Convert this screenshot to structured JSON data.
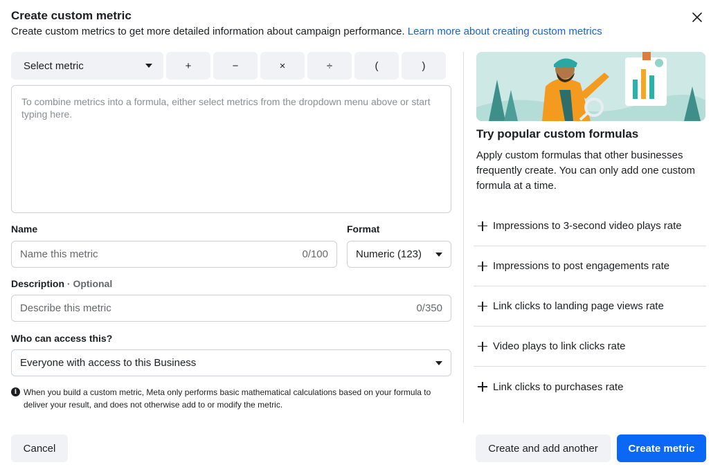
{
  "dialog": {
    "title": "Create custom metric",
    "subtitle": "Create custom metrics to get more detailed information about campaign performance.",
    "learn_more": "Learn more about creating custom metrics"
  },
  "toolbar": {
    "select_metric": "Select metric",
    "operators": [
      "+",
      "−",
      "×",
      "÷",
      "(",
      ")"
    ]
  },
  "formula": {
    "placeholder": "To combine metrics into a formula, either select metrics from the dropdown menu above or start typing here."
  },
  "name": {
    "label": "Name",
    "placeholder": "Name this metric",
    "count": "0/100"
  },
  "format": {
    "label": "Format",
    "value": "Numeric (123)"
  },
  "description": {
    "label": "Description",
    "optional": "· Optional",
    "placeholder": "Describe this metric",
    "count": "0/350"
  },
  "access": {
    "label": "Who can access this?",
    "value": "Everyone with access to this Business"
  },
  "note": "When you build a custom metric, Meta only performs basic mathematical calculations based on your formula to deliver your result, and does not otherwise add to or modify the metric.",
  "sidebar": {
    "title": "Try popular custom formulas",
    "description": "Apply custom formulas that other businesses frequently create. You can only add one custom formula at a time.",
    "formulas": [
      "Impressions to 3-second video plays rate",
      "Impressions to post engagements rate",
      "Link clicks to landing page views rate",
      "Video plays to link clicks rate",
      "Link clicks to purchases rate"
    ]
  },
  "footer": {
    "cancel": "Cancel",
    "create_another": "Create and add another",
    "create": "Create metric"
  },
  "colors": {
    "primary": "#0a68f4",
    "link": "#1763cf",
    "gray_button": "#f0f2f5"
  }
}
